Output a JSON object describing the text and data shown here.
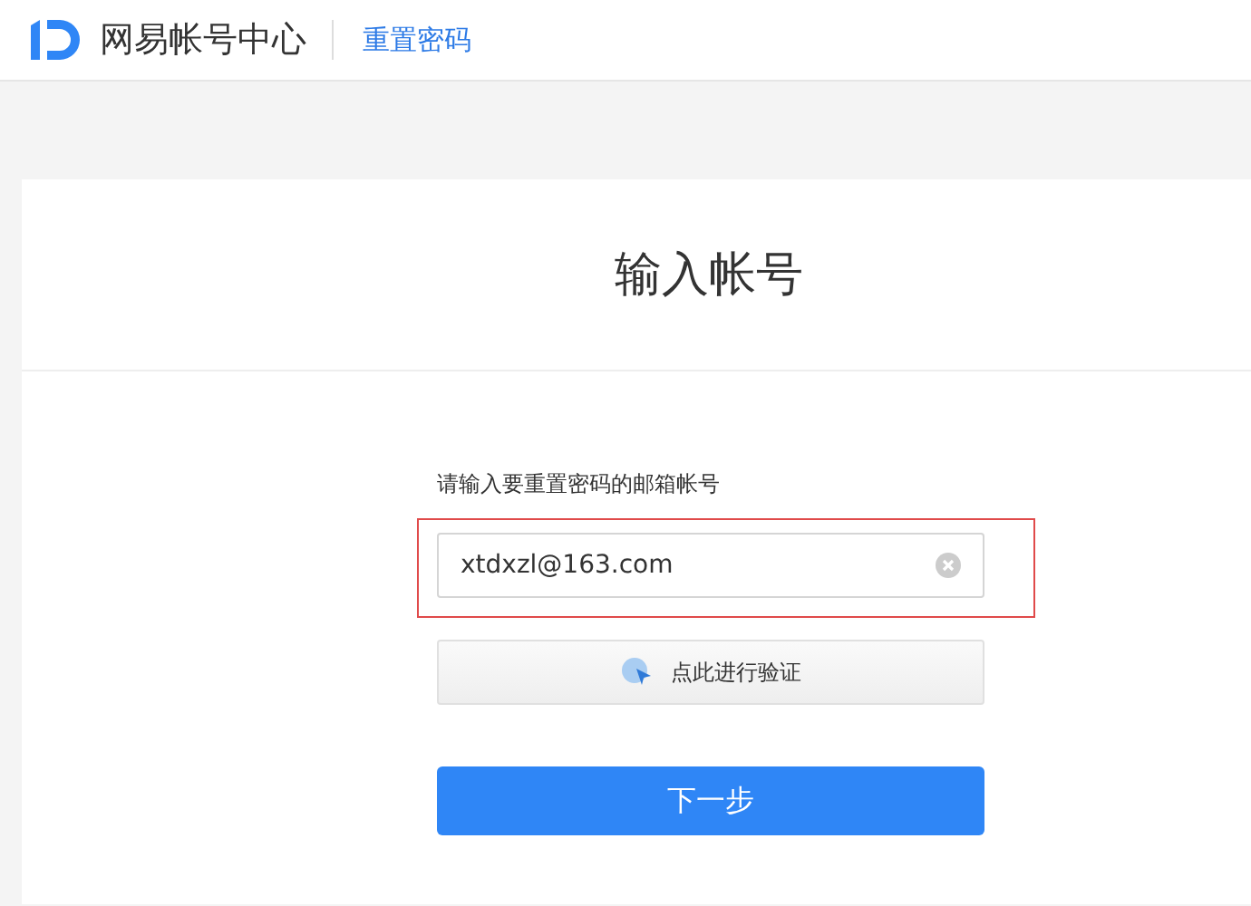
{
  "header": {
    "brand": "网易帐号中心",
    "page": "重置密码"
  },
  "card": {
    "title": "输入帐号",
    "field_label": "请输入要重置密码的邮箱帐号",
    "email": {
      "value": "xtdxzl@163.com"
    },
    "verify_button": "点此进行验证",
    "next_button": "下一步"
  }
}
